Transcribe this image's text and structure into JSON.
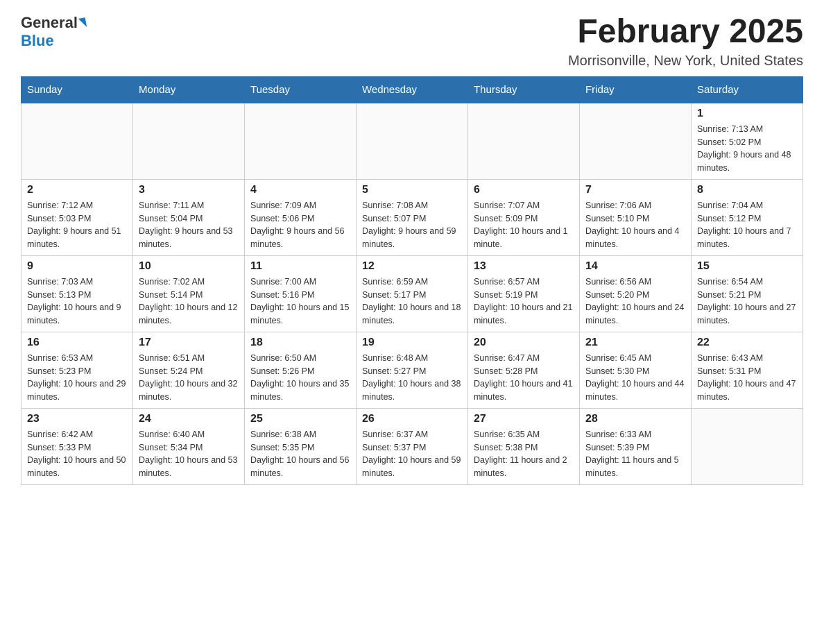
{
  "header": {
    "logo_general": "General",
    "logo_blue": "Blue",
    "month_title": "February 2025",
    "location": "Morrisonville, New York, United States"
  },
  "weekdays": [
    "Sunday",
    "Monday",
    "Tuesday",
    "Wednesday",
    "Thursday",
    "Friday",
    "Saturday"
  ],
  "weeks": [
    [
      {
        "day": "",
        "sunrise": "",
        "sunset": "",
        "daylight": ""
      },
      {
        "day": "",
        "sunrise": "",
        "sunset": "",
        "daylight": ""
      },
      {
        "day": "",
        "sunrise": "",
        "sunset": "",
        "daylight": ""
      },
      {
        "day": "",
        "sunrise": "",
        "sunset": "",
        "daylight": ""
      },
      {
        "day": "",
        "sunrise": "",
        "sunset": "",
        "daylight": ""
      },
      {
        "day": "",
        "sunrise": "",
        "sunset": "",
        "daylight": ""
      },
      {
        "day": "1",
        "sunrise": "Sunrise: 7:13 AM",
        "sunset": "Sunset: 5:02 PM",
        "daylight": "Daylight: 9 hours and 48 minutes."
      }
    ],
    [
      {
        "day": "2",
        "sunrise": "Sunrise: 7:12 AM",
        "sunset": "Sunset: 5:03 PM",
        "daylight": "Daylight: 9 hours and 51 minutes."
      },
      {
        "day": "3",
        "sunrise": "Sunrise: 7:11 AM",
        "sunset": "Sunset: 5:04 PM",
        "daylight": "Daylight: 9 hours and 53 minutes."
      },
      {
        "day": "4",
        "sunrise": "Sunrise: 7:09 AM",
        "sunset": "Sunset: 5:06 PM",
        "daylight": "Daylight: 9 hours and 56 minutes."
      },
      {
        "day": "5",
        "sunrise": "Sunrise: 7:08 AM",
        "sunset": "Sunset: 5:07 PM",
        "daylight": "Daylight: 9 hours and 59 minutes."
      },
      {
        "day": "6",
        "sunrise": "Sunrise: 7:07 AM",
        "sunset": "Sunset: 5:09 PM",
        "daylight": "Daylight: 10 hours and 1 minute."
      },
      {
        "day": "7",
        "sunrise": "Sunrise: 7:06 AM",
        "sunset": "Sunset: 5:10 PM",
        "daylight": "Daylight: 10 hours and 4 minutes."
      },
      {
        "day": "8",
        "sunrise": "Sunrise: 7:04 AM",
        "sunset": "Sunset: 5:12 PM",
        "daylight": "Daylight: 10 hours and 7 minutes."
      }
    ],
    [
      {
        "day": "9",
        "sunrise": "Sunrise: 7:03 AM",
        "sunset": "Sunset: 5:13 PM",
        "daylight": "Daylight: 10 hours and 9 minutes."
      },
      {
        "day": "10",
        "sunrise": "Sunrise: 7:02 AM",
        "sunset": "Sunset: 5:14 PM",
        "daylight": "Daylight: 10 hours and 12 minutes."
      },
      {
        "day": "11",
        "sunrise": "Sunrise: 7:00 AM",
        "sunset": "Sunset: 5:16 PM",
        "daylight": "Daylight: 10 hours and 15 minutes."
      },
      {
        "day": "12",
        "sunrise": "Sunrise: 6:59 AM",
        "sunset": "Sunset: 5:17 PM",
        "daylight": "Daylight: 10 hours and 18 minutes."
      },
      {
        "day": "13",
        "sunrise": "Sunrise: 6:57 AM",
        "sunset": "Sunset: 5:19 PM",
        "daylight": "Daylight: 10 hours and 21 minutes."
      },
      {
        "day": "14",
        "sunrise": "Sunrise: 6:56 AM",
        "sunset": "Sunset: 5:20 PM",
        "daylight": "Daylight: 10 hours and 24 minutes."
      },
      {
        "day": "15",
        "sunrise": "Sunrise: 6:54 AM",
        "sunset": "Sunset: 5:21 PM",
        "daylight": "Daylight: 10 hours and 27 minutes."
      }
    ],
    [
      {
        "day": "16",
        "sunrise": "Sunrise: 6:53 AM",
        "sunset": "Sunset: 5:23 PM",
        "daylight": "Daylight: 10 hours and 29 minutes."
      },
      {
        "day": "17",
        "sunrise": "Sunrise: 6:51 AM",
        "sunset": "Sunset: 5:24 PM",
        "daylight": "Daylight: 10 hours and 32 minutes."
      },
      {
        "day": "18",
        "sunrise": "Sunrise: 6:50 AM",
        "sunset": "Sunset: 5:26 PM",
        "daylight": "Daylight: 10 hours and 35 minutes."
      },
      {
        "day": "19",
        "sunrise": "Sunrise: 6:48 AM",
        "sunset": "Sunset: 5:27 PM",
        "daylight": "Daylight: 10 hours and 38 minutes."
      },
      {
        "day": "20",
        "sunrise": "Sunrise: 6:47 AM",
        "sunset": "Sunset: 5:28 PM",
        "daylight": "Daylight: 10 hours and 41 minutes."
      },
      {
        "day": "21",
        "sunrise": "Sunrise: 6:45 AM",
        "sunset": "Sunset: 5:30 PM",
        "daylight": "Daylight: 10 hours and 44 minutes."
      },
      {
        "day": "22",
        "sunrise": "Sunrise: 6:43 AM",
        "sunset": "Sunset: 5:31 PM",
        "daylight": "Daylight: 10 hours and 47 minutes."
      }
    ],
    [
      {
        "day": "23",
        "sunrise": "Sunrise: 6:42 AM",
        "sunset": "Sunset: 5:33 PM",
        "daylight": "Daylight: 10 hours and 50 minutes."
      },
      {
        "day": "24",
        "sunrise": "Sunrise: 6:40 AM",
        "sunset": "Sunset: 5:34 PM",
        "daylight": "Daylight: 10 hours and 53 minutes."
      },
      {
        "day": "25",
        "sunrise": "Sunrise: 6:38 AM",
        "sunset": "Sunset: 5:35 PM",
        "daylight": "Daylight: 10 hours and 56 minutes."
      },
      {
        "day": "26",
        "sunrise": "Sunrise: 6:37 AM",
        "sunset": "Sunset: 5:37 PM",
        "daylight": "Daylight: 10 hours and 59 minutes."
      },
      {
        "day": "27",
        "sunrise": "Sunrise: 6:35 AM",
        "sunset": "Sunset: 5:38 PM",
        "daylight": "Daylight: 11 hours and 2 minutes."
      },
      {
        "day": "28",
        "sunrise": "Sunrise: 6:33 AM",
        "sunset": "Sunset: 5:39 PM",
        "daylight": "Daylight: 11 hours and 5 minutes."
      },
      {
        "day": "",
        "sunrise": "",
        "sunset": "",
        "daylight": ""
      }
    ]
  ]
}
